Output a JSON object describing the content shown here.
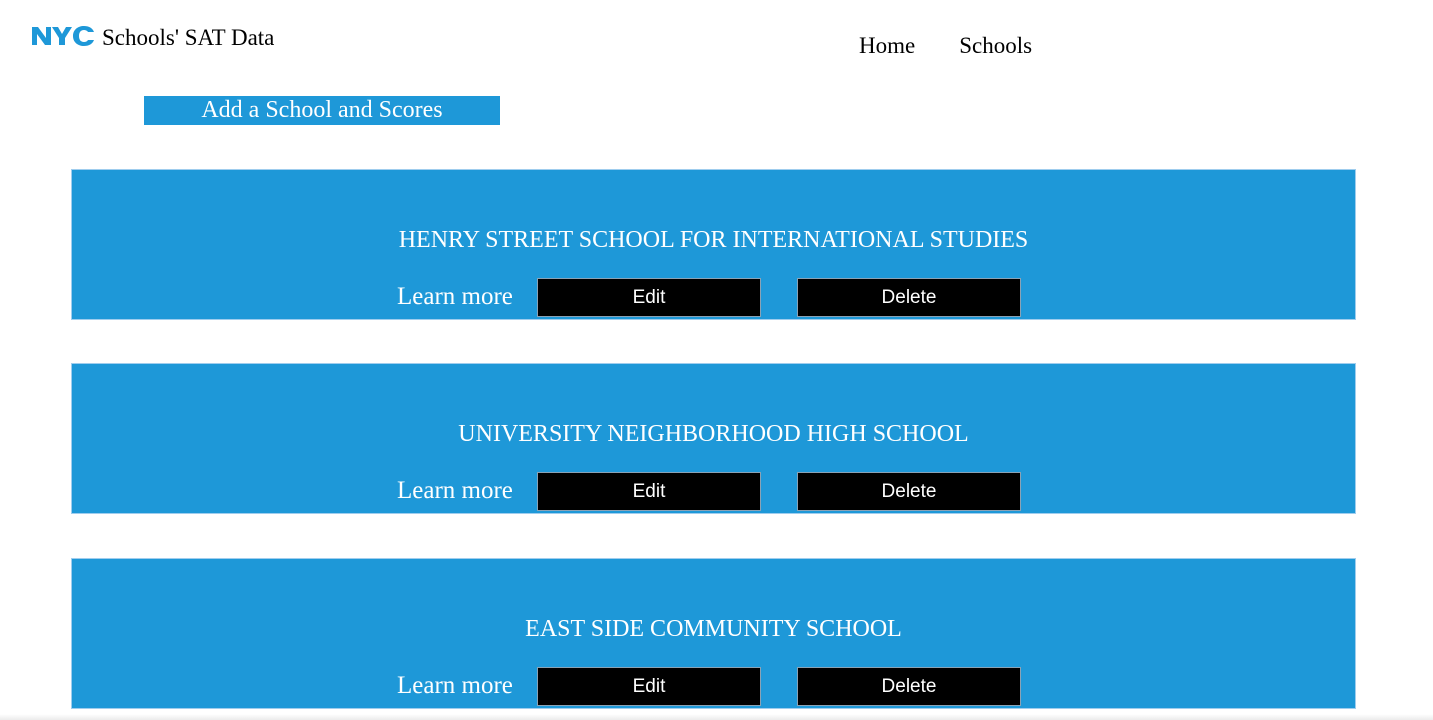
{
  "brand": {
    "logo_icon": "nyc-logo-icon",
    "logo_color": "#1e98d8",
    "logo_text": "NYC",
    "title": "Schools' SAT Data"
  },
  "nav": {
    "items": [
      {
        "label": "Home"
      },
      {
        "label": "Schools"
      }
    ]
  },
  "actions": {
    "add_label": "Add a School and Scores"
  },
  "colors": {
    "accent": "#1e98d8",
    "button_bg": "#000000",
    "button_text": "#ffffff"
  },
  "schools": [
    {
      "name": "HENRY STREET SCHOOL FOR INTERNATIONAL STUDIES",
      "learn_more": "Learn more",
      "edit_label": "Edit",
      "delete_label": "Delete"
    },
    {
      "name": "UNIVERSITY NEIGHBORHOOD HIGH SCHOOL",
      "learn_more": "Learn more",
      "edit_label": "Edit",
      "delete_label": "Delete"
    },
    {
      "name": "EAST SIDE COMMUNITY SCHOOL",
      "learn_more": "Learn more",
      "edit_label": "Edit",
      "delete_label": "Delete"
    }
  ]
}
